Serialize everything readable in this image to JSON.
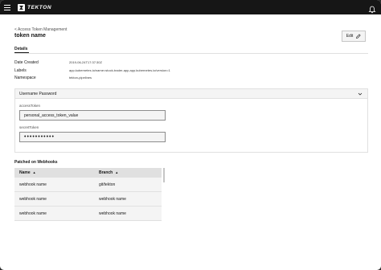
{
  "header": {
    "brand": "TEKTON"
  },
  "breadcrumb": "< Access Token Management",
  "title": "token name",
  "edit_label": "Edit",
  "section_tab": "Details",
  "details": {
    "date_created_label": "Date Created",
    "date_created_value": "2019-06-24T17:37:30Z",
    "labels_label": "Labels",
    "labels_value": "app.kubernetes.io/name=stock-trader-app,app.kubernetes.io/version=1",
    "namespace_label": "Namespace",
    "namespace_value": "tekton-pipelines"
  },
  "accordion": {
    "title": "Username Password",
    "access_token_label": "accessToken",
    "access_token_value": "personal_access_token_value",
    "secret_token_label": "secretToken",
    "secret_token_value": "•••••••••••"
  },
  "webhooks": {
    "title": "Patched on Webhooks",
    "columns": [
      "Name",
      "Branch"
    ],
    "rows": [
      {
        "name": "webhook name",
        "branch": "git/tekton"
      },
      {
        "name": "webhook name",
        "branch": "webhook name"
      },
      {
        "name": "webhook name",
        "branch": "webhook name"
      }
    ]
  }
}
